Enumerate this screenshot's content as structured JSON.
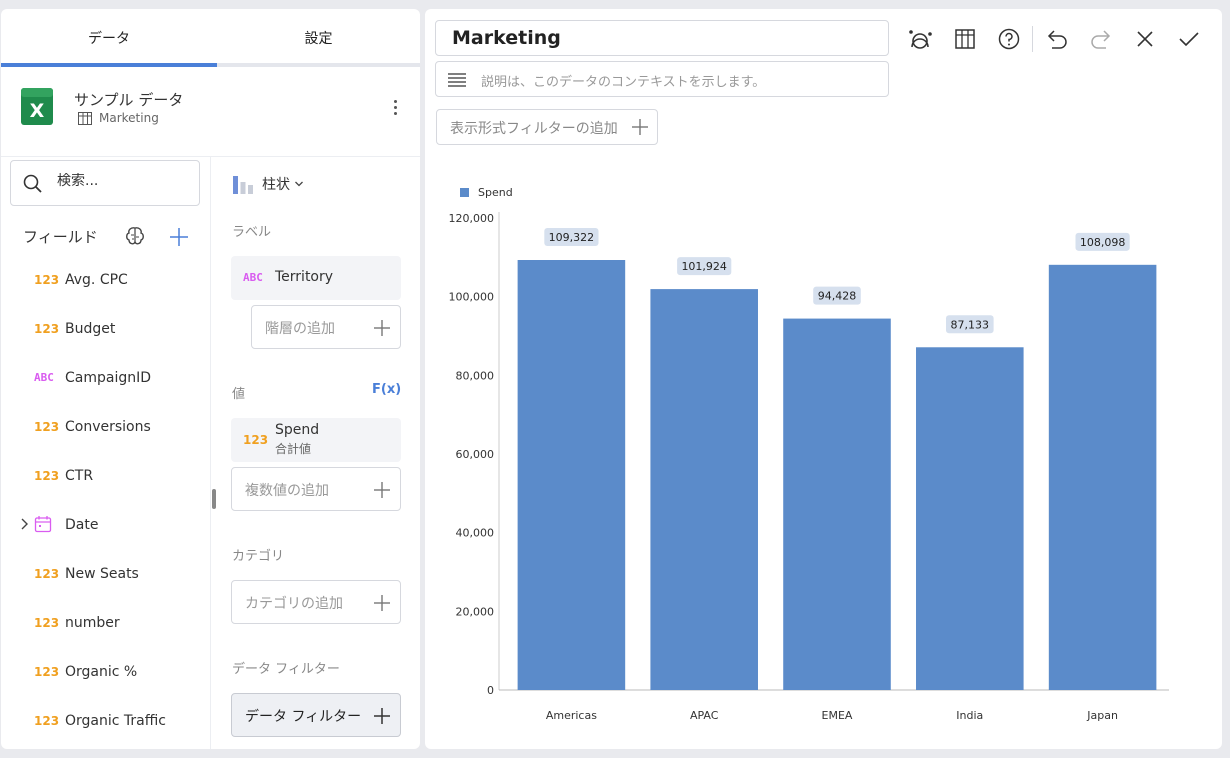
{
  "left_panel": {
    "tabs": [
      {
        "label": "データ"
      },
      {
        "label": "設定"
      }
    ],
    "datasource": {
      "name": "サンプル データ",
      "sheet": "Marketing"
    },
    "search": {
      "placeholder": "検索..."
    },
    "fields_header": "フィールド",
    "fields": [
      {
        "type": "123",
        "name": "Avg. CPC"
      },
      {
        "type": "123",
        "name": "Budget"
      },
      {
        "type": "ABC",
        "name": "CampaignID"
      },
      {
        "type": "123",
        "name": "Conversions"
      },
      {
        "type": "123",
        "name": "CTR"
      },
      {
        "type": "date",
        "name": "Date"
      },
      {
        "type": "123",
        "name": "New Seats"
      },
      {
        "type": "123",
        "name": "number"
      },
      {
        "type": "123",
        "name": "Organic %"
      },
      {
        "type": "123",
        "name": "Organic Traffic"
      }
    ],
    "config": {
      "viz_type": "柱状",
      "label_section": "ラベル",
      "label_field": {
        "type": "ABC",
        "name": "Territory"
      },
      "add_hierarchy": "階層の追加",
      "value_section": "値",
      "fx_label": "F(x)",
      "value_field": {
        "type": "123",
        "name": "Spend",
        "agg": "合計値"
      },
      "add_values": "複数値の追加",
      "category_section": "カテゴリ",
      "add_category": "カテゴリの追加",
      "filter_section": "データ フィルター",
      "filter_button": "データ フィルター"
    }
  },
  "right_panel": {
    "title": "Marketing",
    "description_placeholder": "説明は、このデータのコンテキストを示します。",
    "visual_filter_add": "表示形式フィルターの追加"
  },
  "colors": {
    "accent": "#4a7fd8",
    "bar": "#5b8bca",
    "label_bg": "#d6e0ee"
  },
  "chart_data": {
    "type": "bar",
    "categories": [
      "Americas",
      "APAC",
      "EMEA",
      "India",
      "Japan"
    ],
    "series": [
      {
        "name": "Spend",
        "values": [
          109322,
          101924,
          94428,
          87133,
          108098
        ]
      }
    ],
    "data_labels": [
      "109,322",
      "101,924",
      "94,428",
      "87,133",
      "108,098"
    ],
    "y_ticks": [
      "0",
      "20,000",
      "40,000",
      "60,000",
      "80,000",
      "100,000",
      "120,000"
    ],
    "ylim": [
      0,
      120000
    ],
    "legend": "top-left",
    "grid": false
  }
}
